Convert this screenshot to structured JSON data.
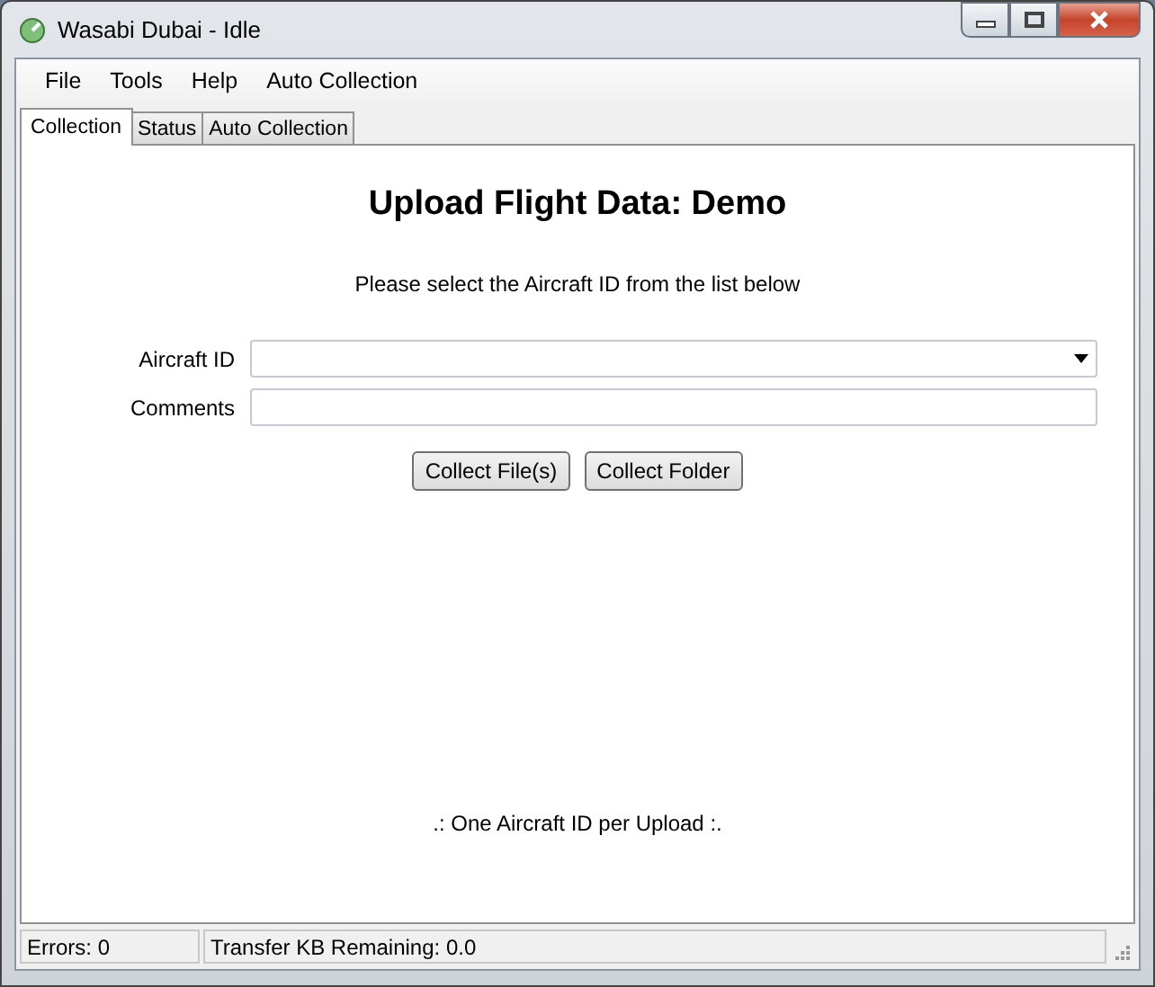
{
  "window": {
    "title": "Wasabi Dubai - Idle"
  },
  "menu": [
    "File",
    "Tools",
    "Help",
    "Auto Collection"
  ],
  "tabs": [
    {
      "label": "Collection",
      "selected": true
    },
    {
      "label": "Status",
      "selected": false
    },
    {
      "label": "Auto Collection",
      "selected": false
    }
  ],
  "heading": "Upload Flight Data: Demo",
  "instruction": "Please select the Aircraft ID from the list below",
  "fields": [
    {
      "label": "Aircraft ID",
      "kind": "dropdown"
    },
    {
      "label": "Comments",
      "kind": "text"
    }
  ],
  "buttons": [
    "Collect File(s)",
    "Collect Folder"
  ],
  "footer_note": ".: One Aircraft ID per Upload :.",
  "status_bar": [
    "Errors: 0",
    "Transfer KB Remaining: 0.0"
  ]
}
